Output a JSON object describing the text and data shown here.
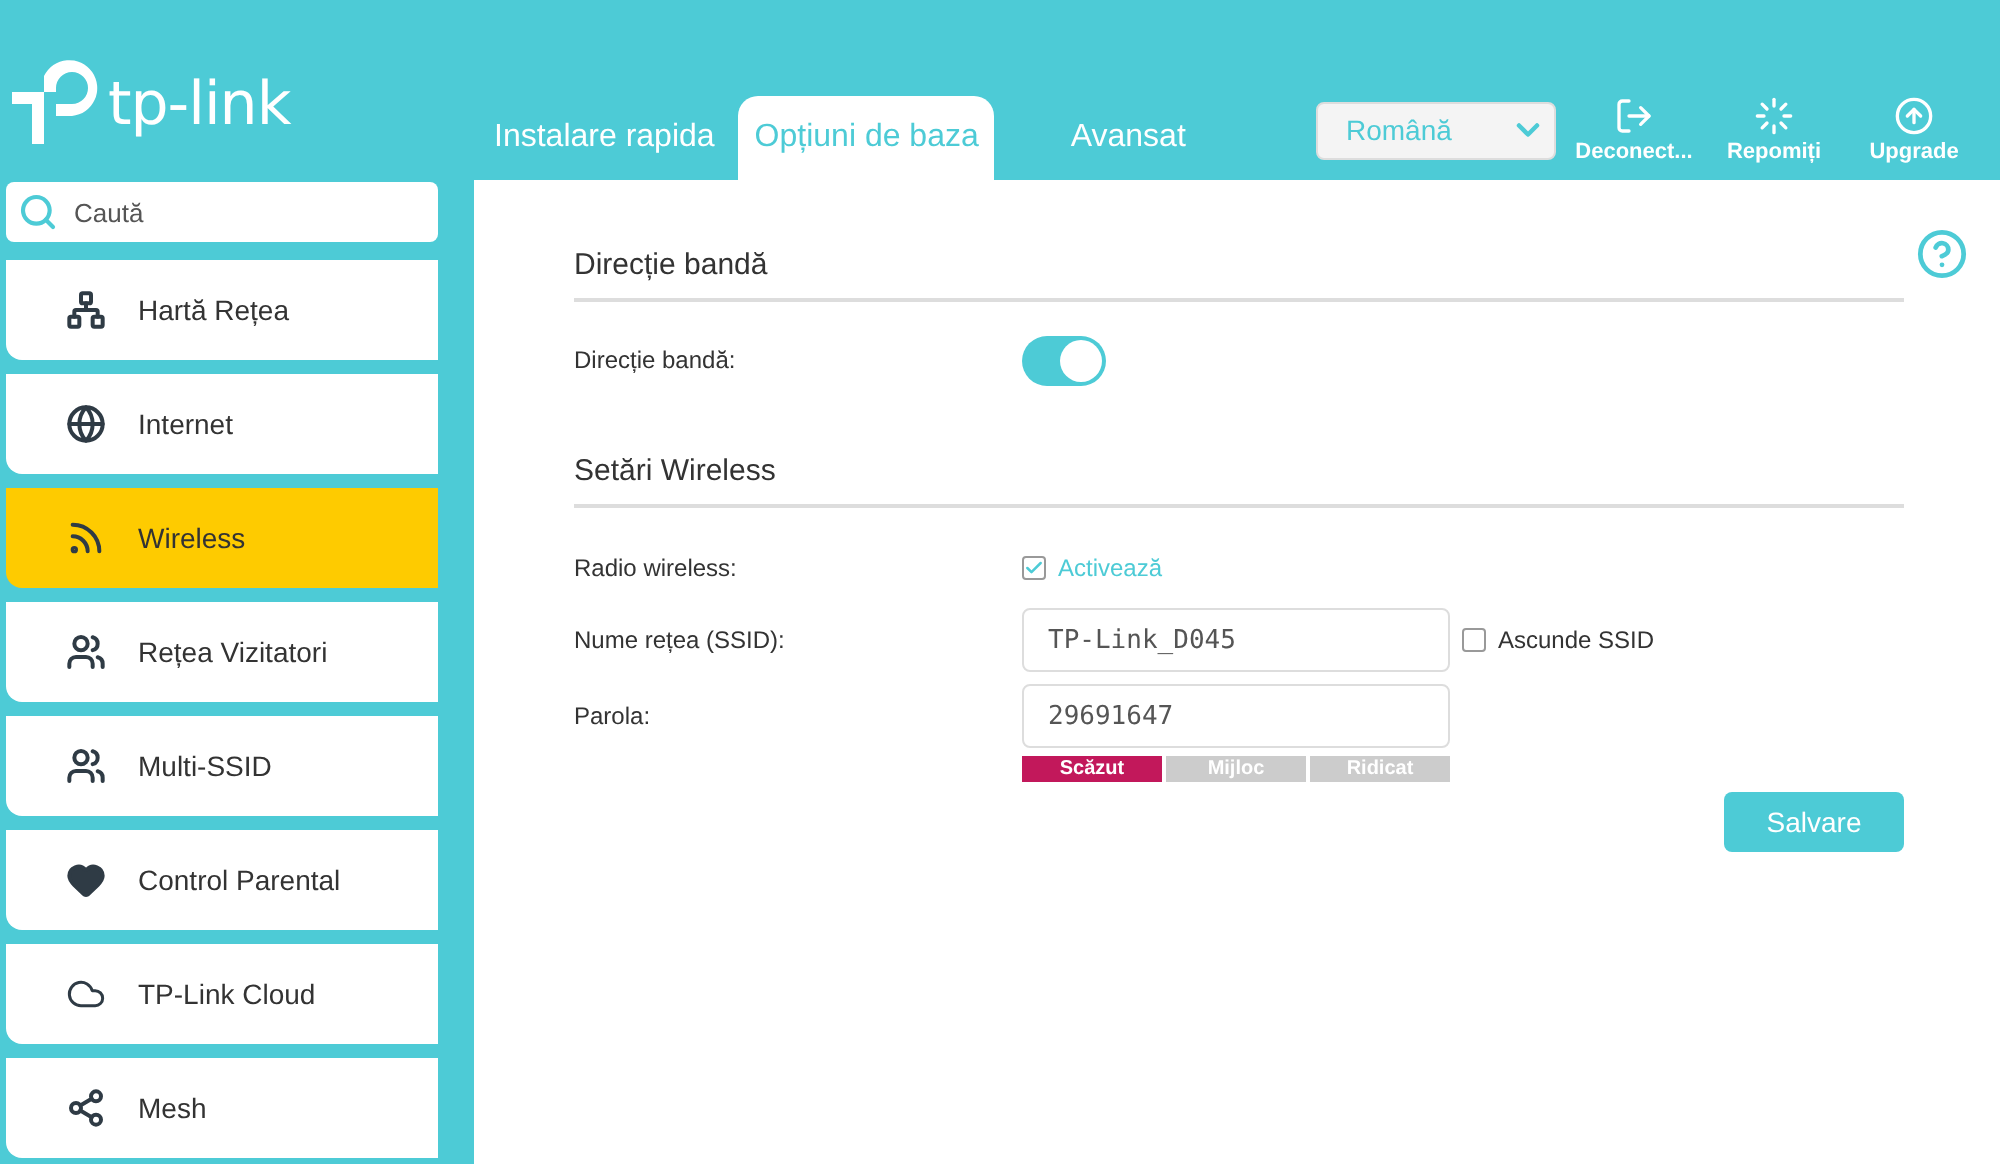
{
  "logo": {
    "text": "tp-link"
  },
  "tabs": [
    {
      "label": "Instalare rapida",
      "selected": false
    },
    {
      "label": "Opțiuni de baza",
      "selected": true
    },
    {
      "label": "Avansat",
      "selected": false
    }
  ],
  "language": {
    "value": "Română"
  },
  "actions": [
    {
      "kind": "logout",
      "label": "Deconect..."
    },
    {
      "kind": "reboot",
      "label": "Repomiți"
    },
    {
      "kind": "upgrade",
      "label": "Upgrade"
    }
  ],
  "search": {
    "placeholder": "Caută"
  },
  "sidebar": {
    "items": [
      {
        "kind": "map",
        "label": "Hartă Rețea",
        "selected": false
      },
      {
        "kind": "internet",
        "label": "Internet",
        "selected": false
      },
      {
        "kind": "wireless",
        "label": "Wireless",
        "selected": true
      },
      {
        "kind": "guest",
        "label": "Rețea Vizitatori",
        "selected": false
      },
      {
        "kind": "guest",
        "label": "Multi-SSID",
        "selected": false
      },
      {
        "kind": "parental",
        "label": "Control Parental",
        "selected": false
      },
      {
        "kind": "cloud",
        "label": "TP-Link Cloud",
        "selected": false
      },
      {
        "kind": "mesh",
        "label": "Mesh",
        "selected": false
      }
    ]
  },
  "band_steering": {
    "title": "Direcție bandă",
    "label": "Direcție bandă:",
    "on": true
  },
  "wireless": {
    "title": "Setări Wireless",
    "radio": {
      "label": "Radio wireless:",
      "option": "Activează",
      "checked": true
    },
    "ssid": {
      "label": "Nume rețea (SSID):",
      "value": "TP-Link_D045",
      "hide_label": "Ascunde SSID",
      "hide_checked": false
    },
    "password": {
      "label": "Parola:",
      "value": "29691647"
    },
    "strength": [
      {
        "label": "Scăzut",
        "selected": true
      },
      {
        "label": "Mijloc",
        "selected": false
      },
      {
        "label": "Ridicat",
        "selected": false
      }
    ],
    "save": "Salvare"
  }
}
